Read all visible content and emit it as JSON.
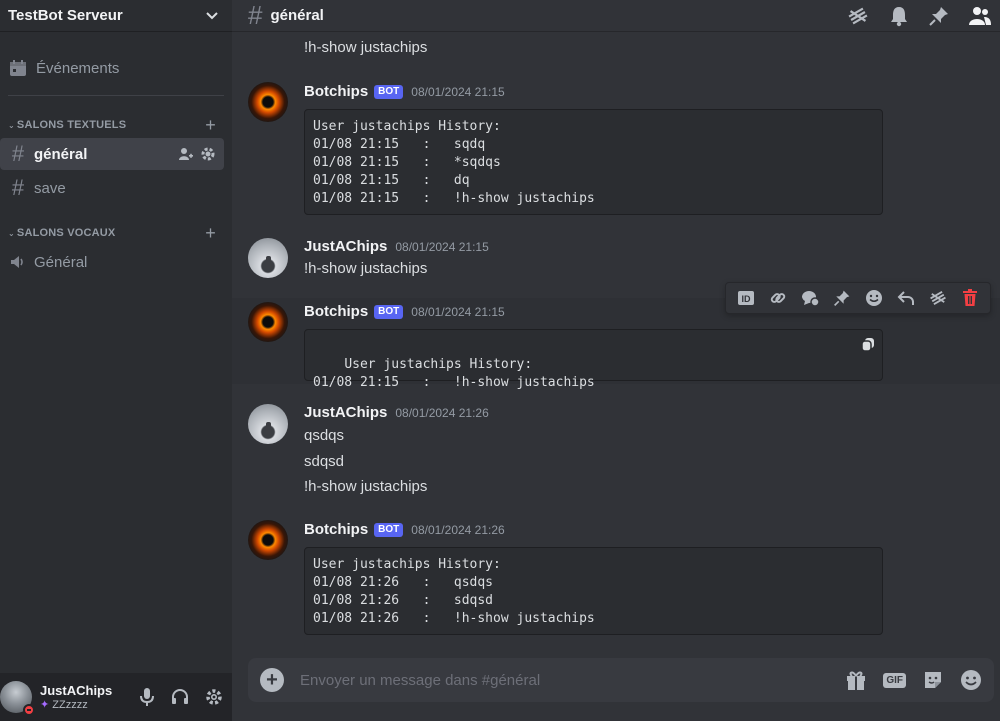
{
  "server": {
    "name": "TestBot Serveur"
  },
  "sidebar": {
    "events_label": "Événements",
    "categories": [
      {
        "label": "SALONS TEXTUELS"
      },
      {
        "label": "SALONS VOCAUX"
      }
    ],
    "channels": [
      {
        "label": "général",
        "type": "text",
        "active": true
      },
      {
        "label": "save",
        "type": "text"
      },
      {
        "label": "Général",
        "type": "voice"
      }
    ]
  },
  "channel_header": {
    "title": "général"
  },
  "messages": {
    "prev_tail": "!h-show justachips",
    "m1": {
      "author": "Botchips",
      "badge": "BOT",
      "time": "08/01/2024 21:15",
      "code": "User justachips History:\n01/08 21:15   :   sqdq\n01/08 21:15   :   *sqdqs\n01/08 21:15   :   dq\n01/08 21:15   :   !h-show justachips"
    },
    "m2": {
      "author": "JustAChips",
      "time": "08/01/2024 21:15",
      "lines": [
        "!h-show justachips"
      ]
    },
    "m3": {
      "author": "Botchips",
      "badge": "BOT",
      "time": "08/01/2024 21:15",
      "code": "User justachips History:\n01/08 21:15   :   !h-show justachips"
    },
    "m4": {
      "author": "JustAChips",
      "time": "08/01/2024 21:26",
      "lines": [
        "qsdqs",
        "sdqsd",
        "!h-show justachips"
      ]
    },
    "m5": {
      "author": "Botchips",
      "badge": "BOT",
      "time": "08/01/2024 21:26",
      "code": "User justachips History:\n01/08 21:26   :   qsdqs\n01/08 21:26   :   sdqsd\n01/08 21:26   :   !h-show justachips"
    }
  },
  "composer": {
    "placeholder": "Envoyer un message dans #général"
  },
  "user_panel": {
    "name": "JustAChips",
    "status": "ZZzzzz",
    "presence_color": "#f23f43"
  },
  "colors": {
    "accent": "#5865f2",
    "danger": "#f23f43"
  }
}
